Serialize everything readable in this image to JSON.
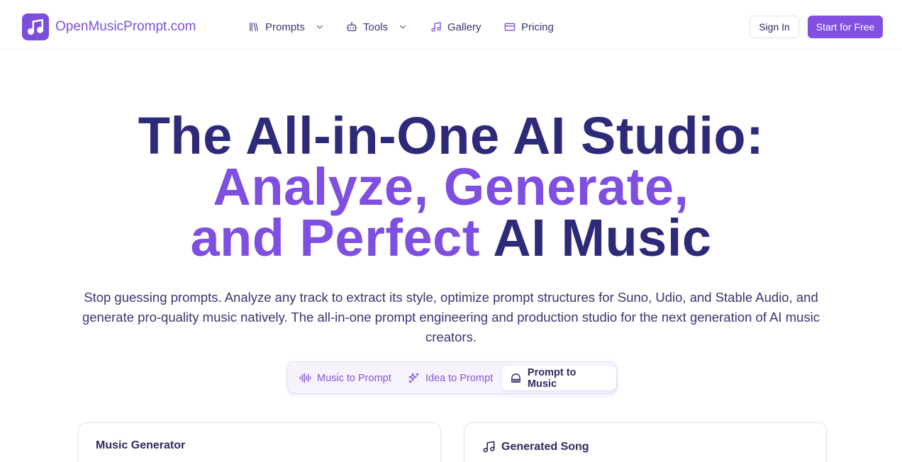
{
  "header": {
    "brand": "OpenMusicPrompt.com",
    "nav": [
      {
        "label": "Prompts",
        "icon": "library-icon",
        "dropdown": true
      },
      {
        "label": "Tools",
        "icon": "robot-icon",
        "dropdown": true
      },
      {
        "label": "Gallery",
        "icon": "music-note-icon",
        "dropdown": false
      },
      {
        "label": "Pricing",
        "icon": "credit-card-icon",
        "dropdown": false
      }
    ],
    "sign_in": "Sign In",
    "start": "Start for Free"
  },
  "hero": {
    "line1": "The All-in-One AI Studio:",
    "line2": "Analyze, Generate,",
    "line3_accent": "and Perfect",
    "line3_rest": " AI Music",
    "subtitle": "Stop guessing prompts. Analyze any track to extract its style, optimize prompt structures for Suno, Udio, and Stable Audio, and generate pro-quality music natively. The all-in-one prompt engineering and production studio for the next generation of AI music creators."
  },
  "tabs": [
    {
      "label": "Music to Prompt",
      "icon": "waveform-icon",
      "active": false
    },
    {
      "label": "Idea to Prompt",
      "icon": "sparkles-icon",
      "active": false
    },
    {
      "label": "Prompt to Music",
      "icon": "piano-icon",
      "active": true
    }
  ],
  "cards": {
    "left_title": "Music Generator",
    "right_title": "Generated Song"
  },
  "colors": {
    "brand": "#7c4ddf",
    "heading": "#2e2a7a",
    "accent": "#7e4fe0"
  }
}
